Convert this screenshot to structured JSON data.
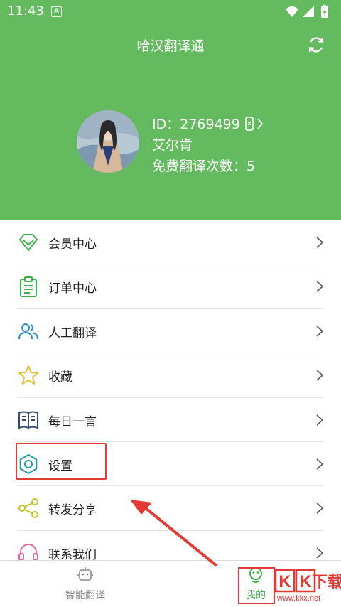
{
  "status": {
    "time": "11:43",
    "badge": "A"
  },
  "header": {
    "title": "哈汉翻译通"
  },
  "profile": {
    "id_label": "ID：2769499",
    "name": "艾尔肯",
    "free_count": "免费翻译次数：5"
  },
  "menu": [
    {
      "label": "会员中心",
      "icon": "diamond-icon",
      "color": "#3db34a"
    },
    {
      "label": "订单中心",
      "icon": "clipboard-icon",
      "color": "#3db34a"
    },
    {
      "label": "人工翻译",
      "icon": "users-icon",
      "color": "#2d8fd5"
    },
    {
      "label": "收藏",
      "icon": "star-icon",
      "color": "#e8c12a"
    },
    {
      "label": "每日一言",
      "icon": "book-icon",
      "color": "#3a4a6b"
    },
    {
      "label": "设置",
      "icon": "gear-icon",
      "color": "#1e9e9e"
    },
    {
      "label": "转发分享",
      "icon": "share-icon",
      "color": "#c6c22a"
    },
    {
      "label": "联系我们",
      "icon": "headset-icon",
      "color": "#e06aa0"
    }
  ],
  "tabs": [
    {
      "label": "智能翻译",
      "active": false
    },
    {
      "label": "我的",
      "active": true
    }
  ],
  "colors": {
    "brand": "#64bb5f",
    "highlight": "#e53935",
    "active_tab": "#3db34a",
    "inactive_tab": "#888888"
  },
  "watermark": {
    "text": "KK下载",
    "url": "www.kkx.net"
  }
}
